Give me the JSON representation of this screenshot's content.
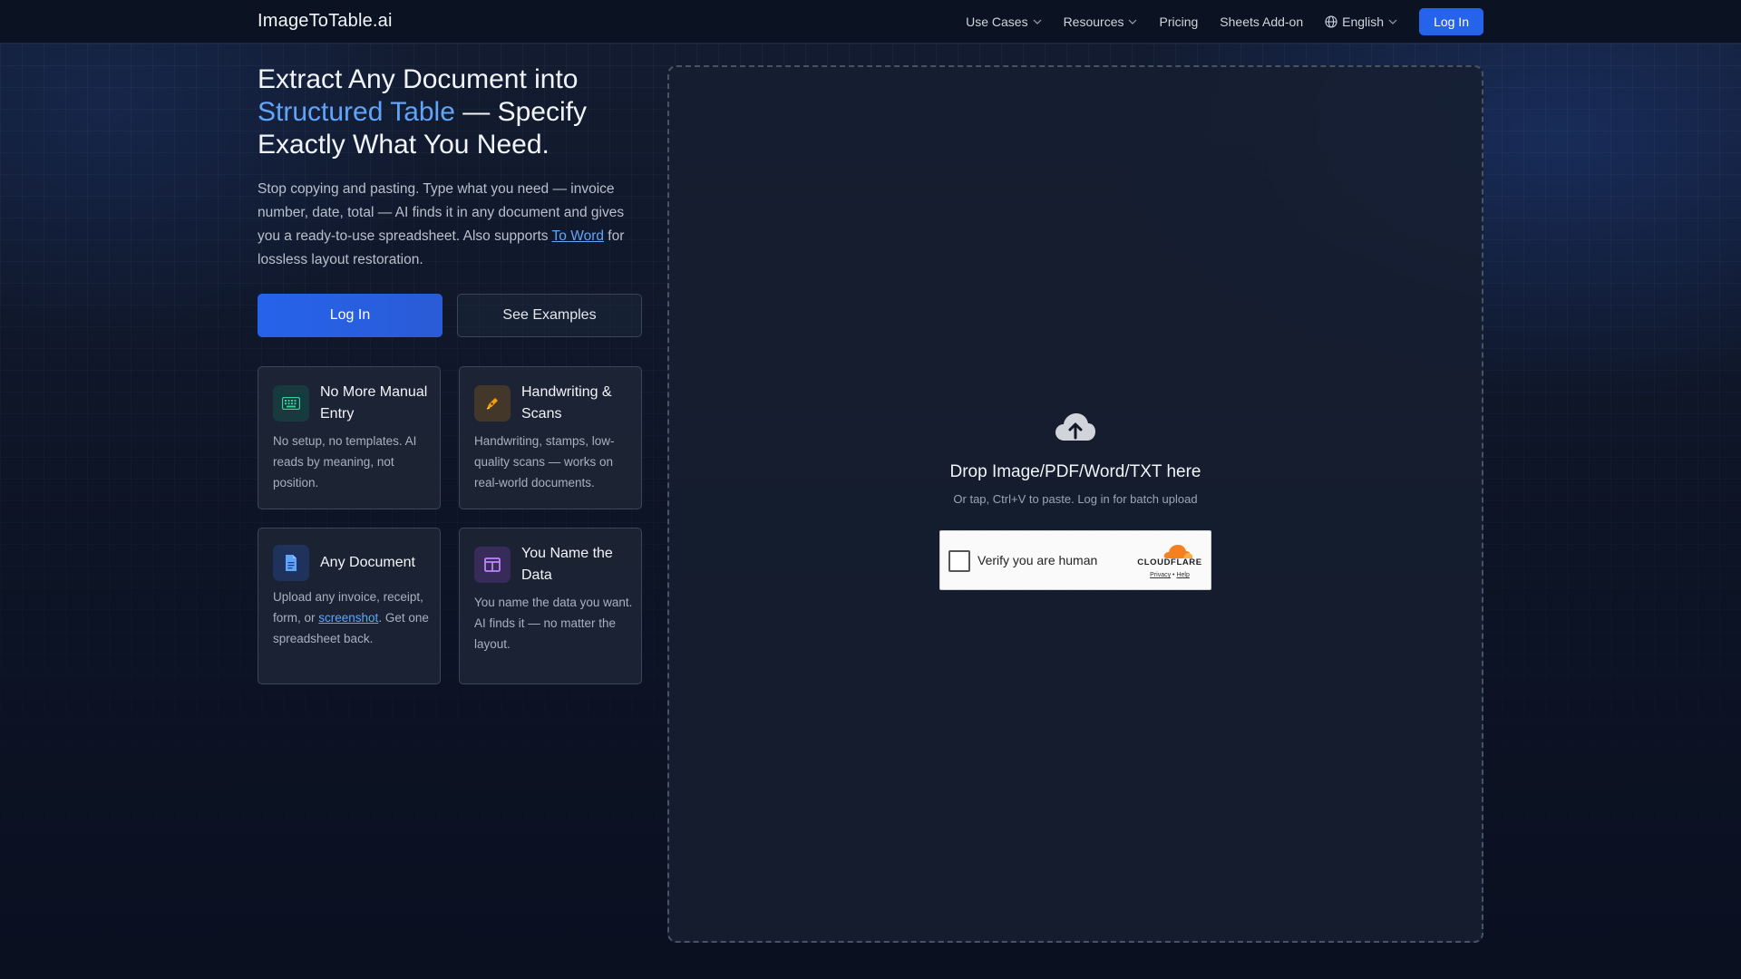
{
  "nav": {
    "brand": "ImageToTable.ai",
    "use_cases": "Use Cases",
    "resources": "Resources",
    "pricing": "Pricing",
    "sheets_addon": "Sheets Add-on",
    "language": "English",
    "login": "Log In"
  },
  "hero": {
    "title_part1": "Extract Any Document into ",
    "title_accent": "Structured Table",
    "title_part2": " — Specify Exactly What You Need.",
    "desc_part1": "Stop copying and pasting. Type what you need — invoice number, date, total — AI finds it in any document and gives you a ready-to-use spreadsheet. Also supports ",
    "desc_link": "To Word",
    "desc_part2": " for lossless layout restoration.",
    "login_button": "Log In",
    "examples_button": "See Examples"
  },
  "features": [
    {
      "title": "No More Manual Entry",
      "desc": "No setup, no templates. AI reads by meaning, not position.",
      "icon": "keyboard-icon",
      "color": "#34d399"
    },
    {
      "title": "Handwriting & Scans",
      "desc": "Handwriting, stamps, low-quality scans — works on real-world documents.",
      "icon": "pen-icon",
      "color": "#f59e0b"
    },
    {
      "title": "Any Document",
      "desc_part1": "Upload any invoice, receipt, form, or ",
      "desc_link": "screenshot",
      "desc_part2": ". Get one spreadsheet back.",
      "icon": "document-icon",
      "color": "#60a5fa"
    },
    {
      "title": "You Name the Data",
      "desc": "You name the data you want. AI finds it — no matter the layout.",
      "icon": "columns-icon",
      "color": "#c084fc"
    }
  ],
  "dropzone": {
    "title": "Drop Image/PDF/Word/TXT here",
    "subtitle": "Or tap, Ctrl+V to paste. Log in for batch upload",
    "icon": "cloud-upload-icon"
  },
  "captcha": {
    "label": "Verify you are human",
    "brand": "CLOUDFLARE",
    "privacy": "Privacy",
    "separator": "•",
    "help": "Help"
  },
  "colors": {
    "accent": "#2563eb",
    "accent_text": "#60a5fa",
    "background": "#0f172a"
  }
}
